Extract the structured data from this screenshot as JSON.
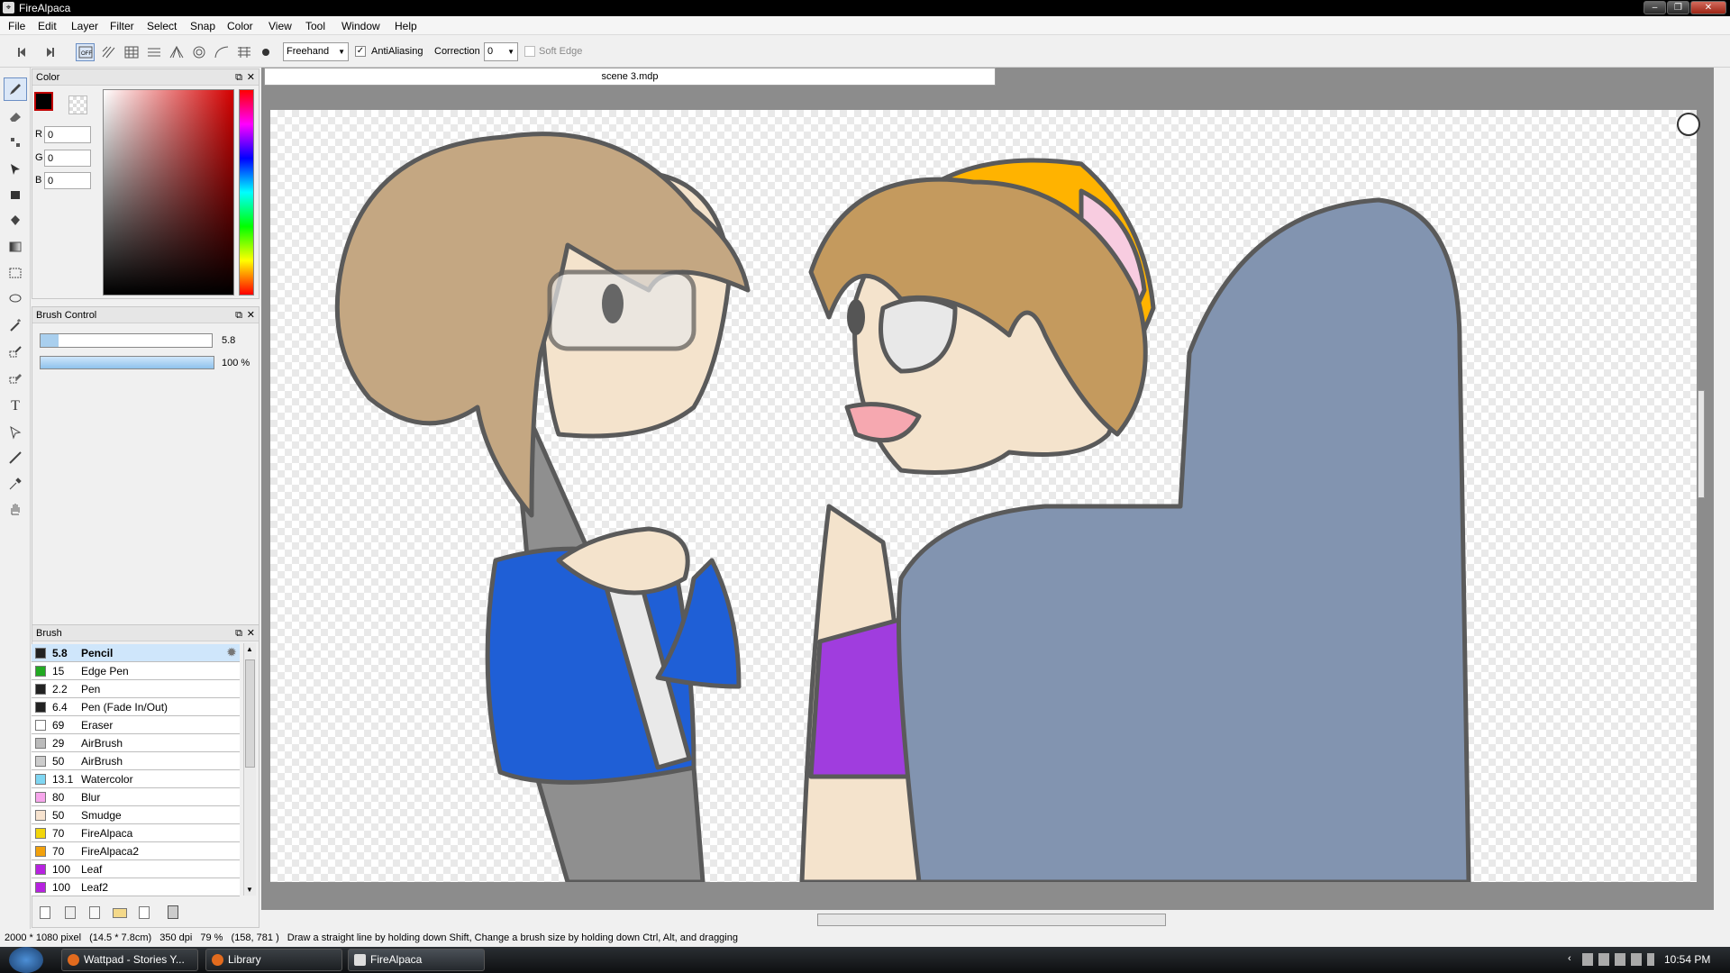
{
  "window": {
    "title": "FireAlpaca"
  },
  "menu": [
    "File",
    "Edit",
    "Layer",
    "Filter",
    "Select",
    "Snap",
    "Color",
    "View",
    "Tool",
    "Window",
    "Help"
  ],
  "toolbar": {
    "mode": "Freehand",
    "antialias_label": "AntiAliasing",
    "antialias_checked": "✓",
    "correction_label": "Correction",
    "correction_value": "0",
    "soft_edge_label": "Soft Edge"
  },
  "color_panel": {
    "title": "Color",
    "r_label": "R",
    "r_value": "0",
    "g_label": "G",
    "g_value": "0",
    "b_label": "B",
    "b_value": "0",
    "foreground": "#000000"
  },
  "brush_control": {
    "title": "Brush Control",
    "size_value": "5.8",
    "opacity_value": "100 %",
    "opacity_fraction": 1.0
  },
  "brush_panel": {
    "title": "Brush",
    "items": [
      {
        "size": "5.8",
        "name": "Pencil",
        "color": "#222222"
      },
      {
        "size": "15",
        "name": "Edge Pen",
        "color": "#22aa22"
      },
      {
        "size": "2.2",
        "name": "Pen",
        "color": "#222222"
      },
      {
        "size": "6.4",
        "name": "Pen (Fade In/Out)",
        "color": "#222222"
      },
      {
        "size": "69",
        "name": "Eraser",
        "color": "#ffffff"
      },
      {
        "size": "29",
        "name": "AirBrush",
        "color": "#bbbbbb"
      },
      {
        "size": "50",
        "name": "AirBrush",
        "color": "#cccccc"
      },
      {
        "size": "13.1",
        "name": "Watercolor",
        "color": "#7fd6f2"
      },
      {
        "size": "80",
        "name": "Blur",
        "color": "#f7a6ec"
      },
      {
        "size": "50",
        "name": "Smudge",
        "color": "#f7e3cf"
      },
      {
        "size": "70",
        "name": "FireAlpaca",
        "color": "#f2d60c"
      },
      {
        "size": "70",
        "name": "FireAlpaca2",
        "color": "#f2a10c"
      },
      {
        "size": "100",
        "name": "Leaf",
        "color": "#b722e0"
      },
      {
        "size": "100",
        "name": "Leaf2",
        "color": "#b722e0"
      }
    ]
  },
  "document": {
    "tab": "scene 3.mdp"
  },
  "status": {
    "size": "2000 * 1080 pixel",
    "physical": "(14.5 * 7.8cm)",
    "dpi": "350 dpi",
    "zoom": "79 %",
    "coords": "(158, 781 )",
    "hint": "Draw a straight line by holding down Shift, Change a brush size by holding down Ctrl, Alt, and dragging"
  },
  "taskbar": {
    "items": [
      "Wattpad - Stories Y...",
      "Library",
      "FireAlpaca"
    ],
    "clock": "10:54 PM"
  }
}
